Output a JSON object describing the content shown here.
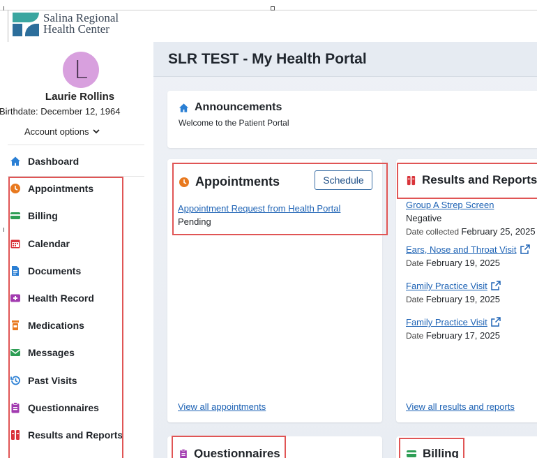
{
  "brand": {
    "name_line1": "Salina Regional",
    "name_line2": "Health Center"
  },
  "user": {
    "initial": "L",
    "name": "Laurie Rollins",
    "birthdate": "Birthdate: December 12, 1964",
    "account_options": "Account options"
  },
  "nav": {
    "dashboard": "Dashboard",
    "items": [
      {
        "label": "Appointments",
        "icon": "clock-icon",
        "color": "#e8791f"
      },
      {
        "label": "Billing",
        "icon": "credit-card-icon",
        "color": "#2e9e55"
      },
      {
        "label": "Calendar",
        "icon": "calendar-icon",
        "color": "#d9343a"
      },
      {
        "label": "Documents",
        "icon": "document-icon",
        "color": "#2a7fd4"
      },
      {
        "label": "Health Record",
        "icon": "health-record-icon",
        "color": "#a23bb0"
      },
      {
        "label": "Medications",
        "icon": "pill-bottle-icon",
        "color": "#e8791f"
      },
      {
        "label": "Messages",
        "icon": "envelope-icon",
        "color": "#2e9e55"
      },
      {
        "label": "Past Visits",
        "icon": "history-icon",
        "color": "#2a7fd4"
      },
      {
        "label": "Questionnaires",
        "icon": "clipboard-icon",
        "color": "#a23bb0"
      },
      {
        "label": "Results and Reports",
        "icon": "test-tubes-icon",
        "color": "#d9343a"
      }
    ]
  },
  "main": {
    "title": "SLR TEST - My Health Portal",
    "announcements": {
      "title": "Announcements",
      "text": "Welcome to the Patient Portal"
    },
    "appointments": {
      "title": "Appointments",
      "schedule_label": "Schedule",
      "request_link": "Appointment Request from Health Portal",
      "request_status": "Pending",
      "view_all": "View all appointments"
    },
    "results": {
      "title": "Results and Reports",
      "items": [
        {
          "name": "Group A Strep Screen",
          "value": "Negative",
          "date_label": "Date collected",
          "date": "February 25, 2025"
        },
        {
          "name": "Ears, Nose and Throat Visit",
          "date_label": "Date",
          "date": "February 19, 2025"
        },
        {
          "name": "Family Practice Visit",
          "date_label": "Date",
          "date": "February 19, 2025"
        },
        {
          "name": "Family Practice Visit",
          "date_label": "Date",
          "date": "February 17, 2025"
        }
      ],
      "view_all": "View all results and reports"
    },
    "questionnaires": {
      "title": "Questionnaires"
    },
    "billing": {
      "title": "Billing"
    }
  },
  "colors": {
    "accent_blue": "#1e63b5",
    "highlight_red": "#e05555",
    "avatar_bg": "#d8a0de"
  }
}
